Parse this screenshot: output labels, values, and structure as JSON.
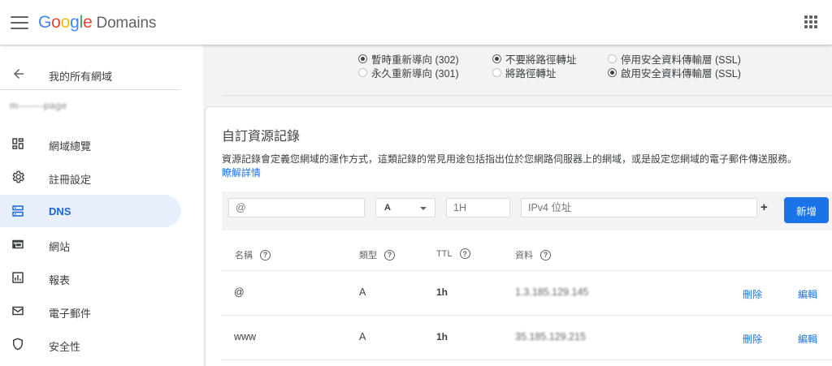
{
  "header": {
    "brand_google": [
      "G",
      "o",
      "o",
      "g",
      "l",
      "e"
    ],
    "brand_suffix": "Domains",
    "brand_colors": [
      "#4285f4",
      "#ea4335",
      "#fbbc05",
      "#4285f4",
      "#34a853",
      "#ea4335"
    ]
  },
  "sidebar": {
    "back_label": "我的所有網域",
    "domain_name": "m-------page",
    "items": [
      {
        "label": "網域總覽",
        "icon": "dashboard-icon"
      },
      {
        "label": "註冊設定",
        "icon": "gear-icon"
      },
      {
        "label": "DNS",
        "icon": "dns-icon",
        "active": true
      },
      {
        "label": "網站",
        "icon": "web-icon"
      },
      {
        "label": "報表",
        "icon": "report-icon"
      },
      {
        "label": "電子郵件",
        "icon": "mail-icon"
      },
      {
        "label": "安全性",
        "icon": "shield-icon"
      }
    ]
  },
  "forwarding": {
    "redirect_type": [
      {
        "label": "暫時重新導向 (302)",
        "selected": true
      },
      {
        "label": "永久重新導向 (301)",
        "selected": false
      }
    ],
    "path_forwarding": [
      {
        "label": "不要將路徑轉址",
        "selected": true
      },
      {
        "label": "將路徑轉址",
        "selected": false
      }
    ],
    "ssl": [
      {
        "label": "停用安全資料傳輸層 (SSL)",
        "selected": false
      },
      {
        "label": "啟用安全資料傳輸層 (SSL)",
        "selected": true
      }
    ]
  },
  "custom_records": {
    "title": "自訂資源記錄",
    "description": "資源記錄會定義您網域的運作方式，這類記錄的常見用途包括指出位於您網路伺服器上的網域，或是設定您網域的電子郵件傳送服務。",
    "learn_more": "瞭解詳情",
    "form": {
      "name_placeholder": "@",
      "type_value": "A",
      "ttl_placeholder": "1H",
      "data_placeholder": "IPv4 位址",
      "plus": "+",
      "add_label": "新增"
    },
    "columns": [
      "名稱",
      "類型",
      "TTL",
      "資料"
    ],
    "help_glyph": "?",
    "rows": [
      {
        "name": "@",
        "type": "A",
        "ttl": "1h",
        "data": "1.3.185.129.145",
        "delete": "刪除",
        "edit": "編輯"
      },
      {
        "name": "www",
        "type": "A",
        "ttl": "1h",
        "data": "35.185.129.215",
        "delete": "刪除",
        "edit": "編輯"
      }
    ]
  }
}
